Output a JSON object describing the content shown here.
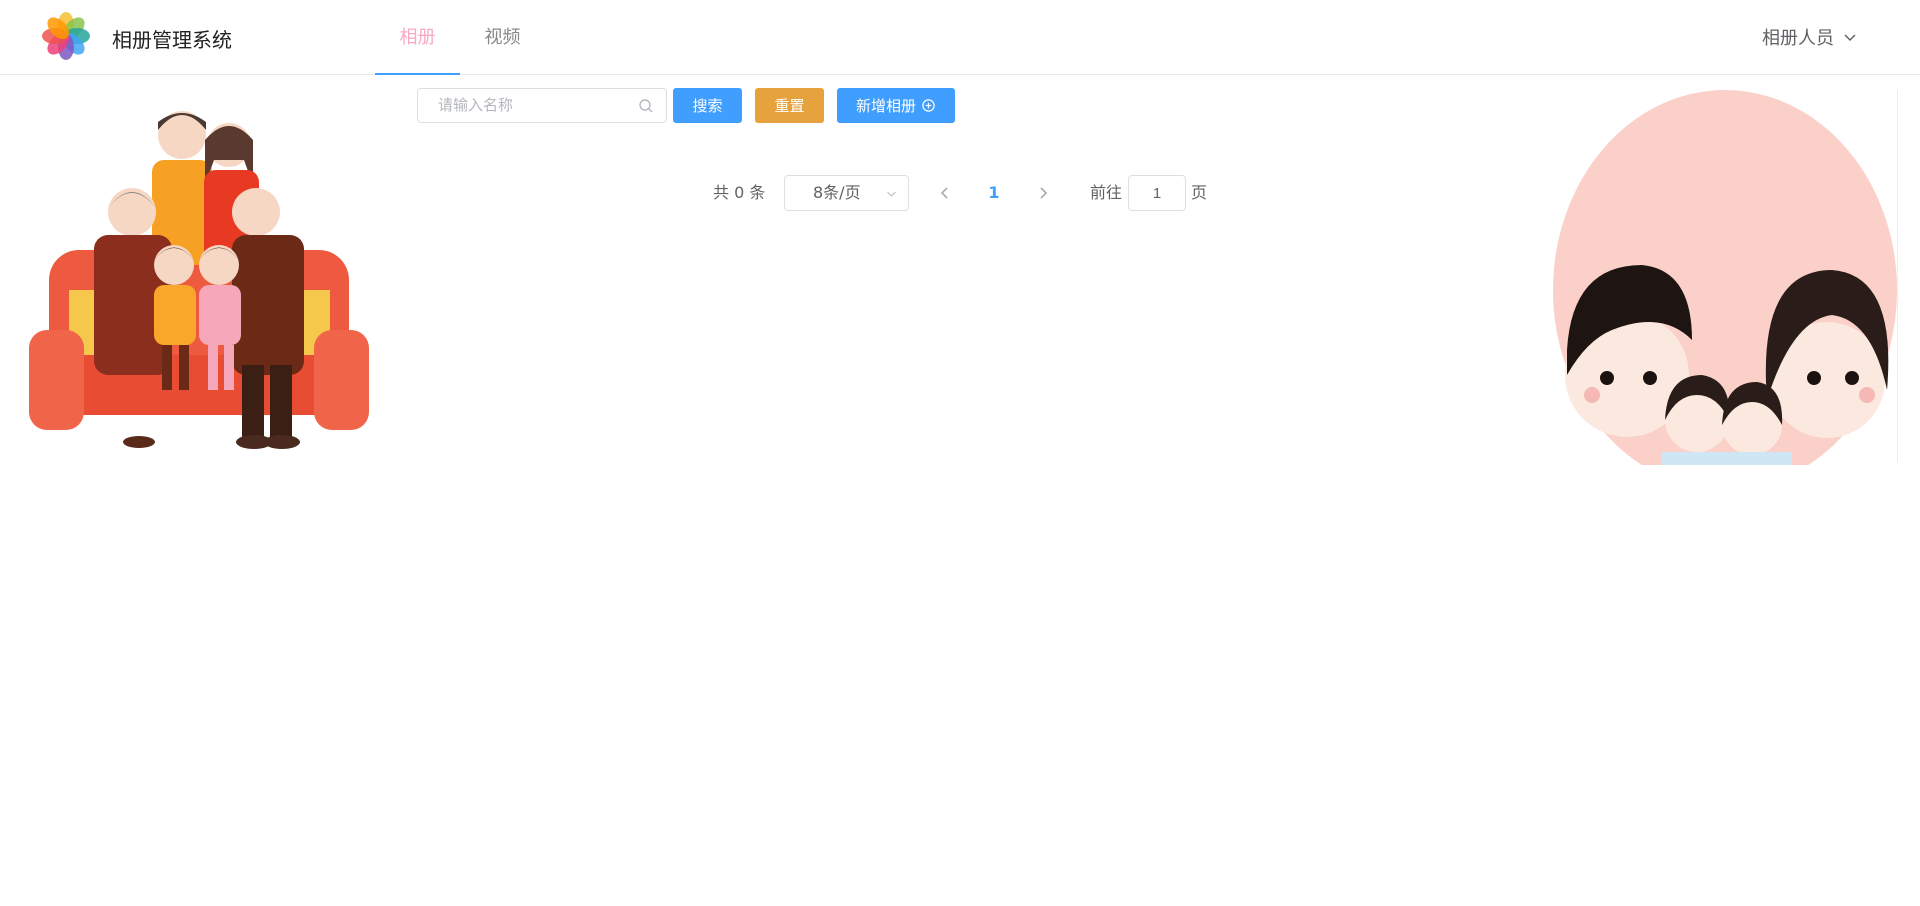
{
  "header": {
    "app_title": "相册管理系统",
    "tabs": [
      {
        "label": "相册",
        "active": true
      },
      {
        "label": "视频",
        "active": false
      }
    ],
    "user_menu_label": "相册人员"
  },
  "toolbar": {
    "search_placeholder": "请输入名称",
    "search_label": "搜索",
    "reset_label": "重置",
    "add_label": "新增相册"
  },
  "pagination": {
    "total_text": "共 0 条",
    "page_size": "8条/页",
    "current_page": "1",
    "goto_label": "前往",
    "goto_value": "1",
    "page_suffix": "页"
  },
  "colors": {
    "primary": "#409eff",
    "warning": "#e6a23c",
    "active_tab": "#f7a9c4"
  }
}
